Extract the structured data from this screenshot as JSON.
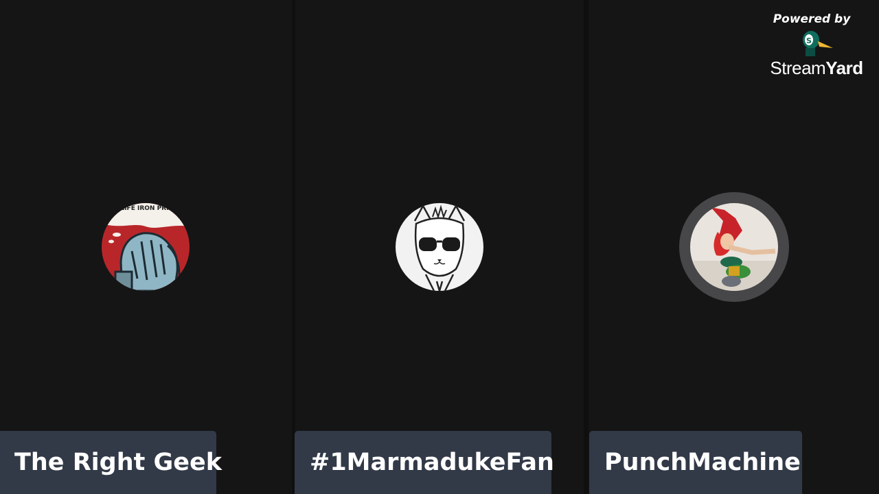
{
  "branding": {
    "powered_by": "Powered by",
    "brand_prefix": "Stream",
    "brand_suffix": "Yard",
    "logo_icon": "duck-logo-icon"
  },
  "participants": [
    {
      "name": "The Right Geek",
      "avatar_icon": "facepalm-comic-avatar",
      "avatar_text": "MY LIFE IRON PRISON",
      "speaking": false
    },
    {
      "name": "#1MarmadukeFan",
      "avatar_icon": "cat-sunglasses-avatar",
      "speaking": false
    },
    {
      "name": "PunchMachine",
      "avatar_icon": "action-figure-avatar",
      "speaking": true
    }
  ],
  "colors": {
    "background": "#151516",
    "name_tag": "#323947",
    "name_text": "#ffffff",
    "speaking_ring": "#474749"
  }
}
